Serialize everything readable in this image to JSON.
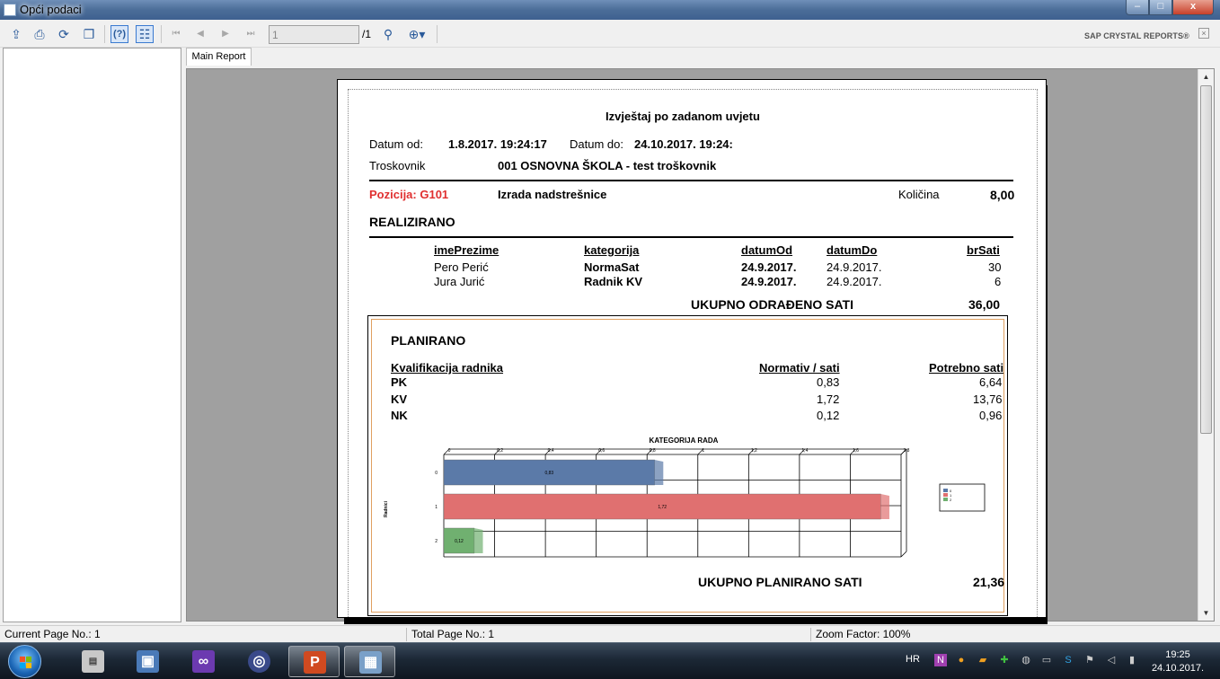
{
  "window": {
    "title": "Opći podaci",
    "buttons": {
      "minimize": "‒",
      "maximize": "□",
      "close": "x"
    }
  },
  "toolbar": {
    "page_value": "1",
    "page_total": "/1",
    "brand": "SAP CRYSTAL REPORTS®",
    "icons": [
      "export-icon",
      "print-icon",
      "refresh-icon",
      "copy-icon",
      "help-icon",
      "group-tree-icon",
      "first-page-icon",
      "prev-page-icon",
      "next-page-icon",
      "last-page-icon",
      "find-icon",
      "zoom-icon"
    ]
  },
  "tabs": [
    {
      "label": "Main Report"
    }
  ],
  "report": {
    "title": "Izvještaj po zadanom uvjetu",
    "datum_od_label": "Datum od:",
    "datum_od": "1.8.2017. 19:24:17",
    "datum_do_label": "Datum do:",
    "datum_do": "24.10.2017. 19:24:",
    "troskovnik_label": "Troskovnik",
    "troskovnik": "001 OSNOVNA ŠKOLA - test troškovnik",
    "pozicija": "Pozicija: G101",
    "pozicija_desc": "Izrada nadstrešnice",
    "kolicina_label": "Količina",
    "kolicina": "8,00",
    "realizirano": {
      "heading": "REALIZIRANO",
      "columns": [
        "imePrezime",
        "kategorija",
        "datumOd",
        "datumDo",
        "brSati"
      ],
      "rows": [
        [
          "Pero Perić",
          "NormaSat",
          "24.9.2017.",
          "24.9.2017.",
          "30"
        ],
        [
          "Jura Jurić",
          "Radnik KV",
          "24.9.2017.",
          "24.9.2017.",
          "6"
        ]
      ],
      "total_label": "UKUPNO ODRAĐENO SATI",
      "total": "36,00"
    },
    "planirano": {
      "heading": "PLANIRANO",
      "columns": [
        "Kvalifikacija radnika",
        "Normativ / sati",
        "Potrebno sati"
      ],
      "rows": [
        [
          "PK",
          "0,83",
          "6,64"
        ],
        [
          "KV",
          "1,72",
          "13,76"
        ],
        [
          "NK",
          "0,12",
          "0,96"
        ]
      ],
      "total_label": "UKUPNO PLANIRANO SATI",
      "total": "21,36"
    }
  },
  "chart_data": {
    "type": "bar",
    "orientation": "horizontal",
    "title": "KATEGORIJA RADA",
    "ylabel": "Radnici",
    "categories": [
      "0",
      "1",
      "2"
    ],
    "values": [
      0.83,
      1.72,
      0.12
    ],
    "value_labels": [
      "0,83",
      "1,72",
      "0,12"
    ],
    "xlim": [
      0,
      1.8
    ],
    "xticks": [
      "0",
      "0,2",
      "0,4",
      "0,6",
      "0,8",
      "1",
      "1,2",
      "1,4",
      "1,6",
      "1,8"
    ],
    "colors": [
      "#5b7aa8",
      "#e07070",
      "#70b070"
    ],
    "legend": [
      "0",
      "1",
      "2"
    ],
    "legend_position": "right",
    "grid": true
  },
  "status": {
    "current_page": "Current Page No.: 1",
    "total_page": "Total Page No.: 1",
    "zoom": "Zoom Factor: 100%"
  },
  "taskbar": {
    "language": "HR",
    "time": "19:25",
    "date": "24.10.2017.",
    "apps": [
      "file-manager-app",
      "computer-app",
      "visual-studio-app",
      "browser-app",
      "powerpoint-app",
      "pc-app"
    ]
  }
}
